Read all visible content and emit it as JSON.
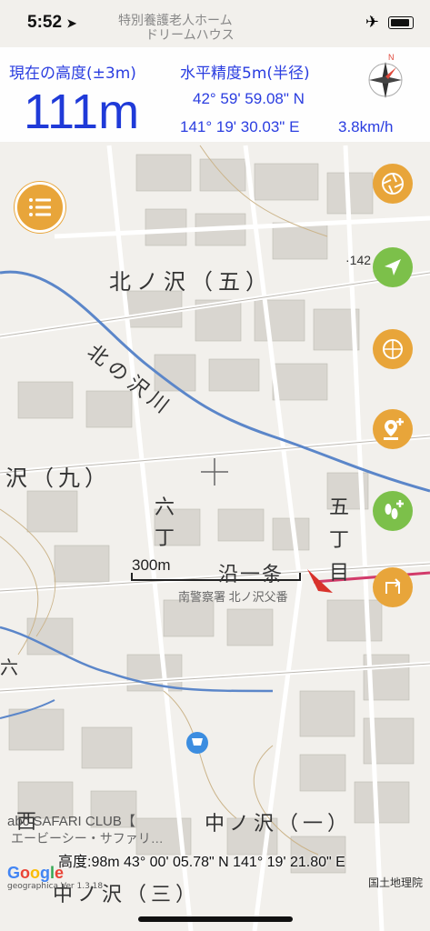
{
  "status_bar": {
    "time": "5:52"
  },
  "header": {
    "altitude_label": "現在の高度(±3m)",
    "accuracy_label": "水平精度5m(半径)",
    "altitude_value": "111m",
    "latitude": "42° 59' 59.08\" N",
    "longitude": "141° 19' 30.03\" E",
    "speed": "3.8km/h"
  },
  "map": {
    "labels": {
      "top_a": "特別養護老人ホーム",
      "top_b": "ドリームハウス",
      "district_5": "北ノ沢（五）",
      "district_9": "沢（九）",
      "river": "北の沢川",
      "roku": "六",
      "cho": "丁",
      "go": "五",
      "cho2": "丁",
      "me": "目",
      "ichijo": "沿一条",
      "bus": "南警察署 北ノ沢父番",
      "naka1": "中ノ沢（一）",
      "naka3": "中ノ沢（三）",
      "nishi": "西",
      "roku2": "六",
      "spot": "·142"
    },
    "scale_label": "300m",
    "poi_name": "abc SAFARI CLUB【",
    "poi_sub": "エービーシー・サファリ…",
    "footer_coords": "高度:98m  43° 00' 05.78\" N 141° 19' 21.80\" E",
    "google": "Google",
    "version": "geographica Ver 1.3.18",
    "gsi": "国土地理院"
  },
  "colors": {
    "accent_blue": "#2a3de0",
    "orange": "#e8a53a",
    "green": "#7cc04a"
  }
}
